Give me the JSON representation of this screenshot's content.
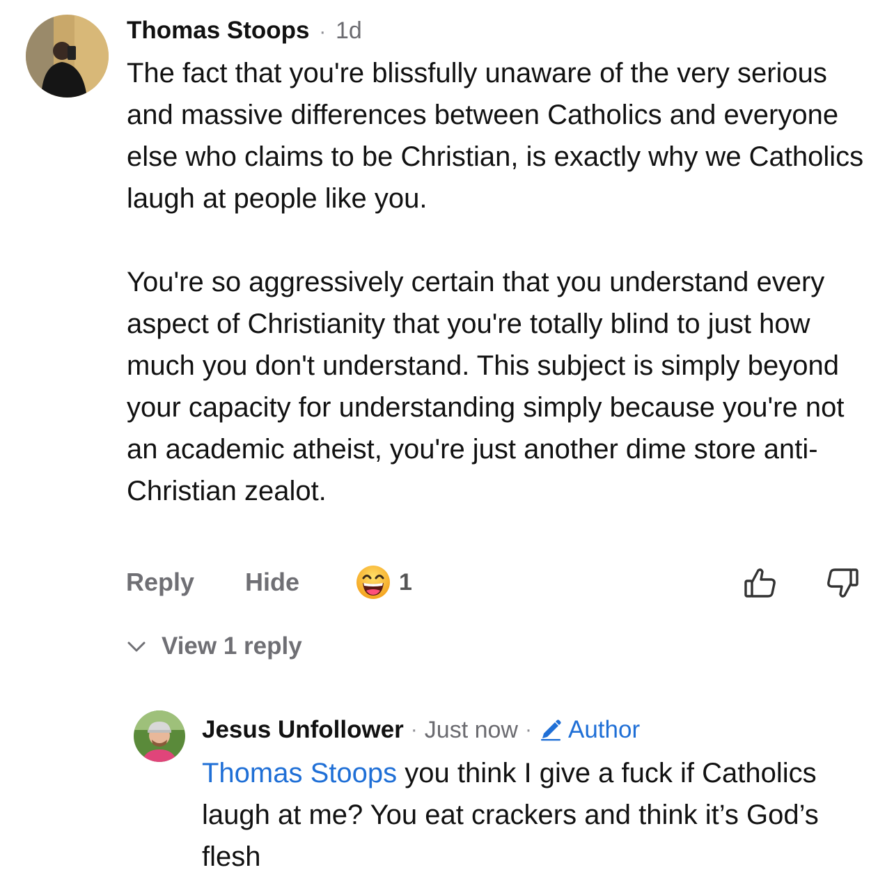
{
  "comment": {
    "author": "Thomas Stoops",
    "separator": "·",
    "time": "1d",
    "paragraphs": [
      "The fact that you're blissfully unaware of the very serious and massive differences between Catholics and everyone else who claims to be Christian, is exactly why we Catholics laugh at people like you.",
      "You're so aggressively certain that you understand every aspect of Christianity that you're totally blind to just how much you don't understand. This subject is simply beyond your capacity for understanding simply because you're not an academic atheist, you're just another dime store anti-Christian zealot."
    ],
    "actions": {
      "reply": "Reply",
      "hide": "Hide",
      "reaction_count": "1"
    },
    "view_replies": "View 1 reply"
  },
  "reply": {
    "author": "Jesus Unfollower",
    "separator": "·",
    "time": "Just now",
    "badge": "Author",
    "mention": "Thomas Stoops",
    "text": " you think I give a fuck if Catholics laugh at me? You eat crackers and think it’s God’s flesh"
  },
  "colors": {
    "link": "#1f6fd6",
    "muted": "#6f6f74"
  }
}
